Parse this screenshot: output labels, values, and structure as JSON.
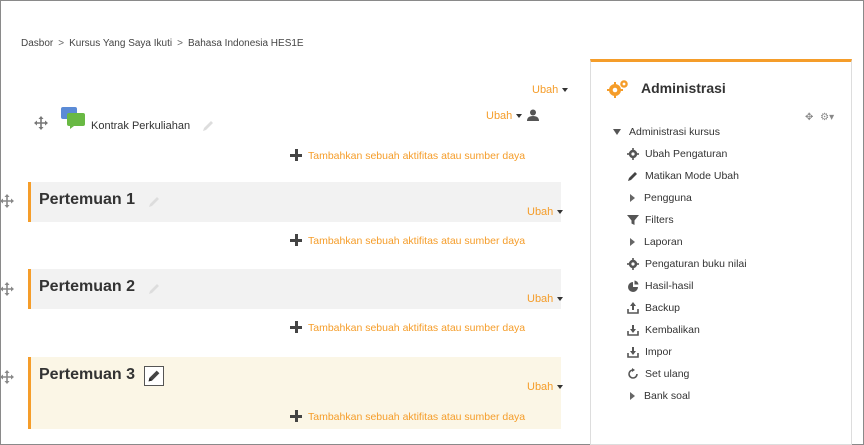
{
  "breadcrumb": {
    "items": [
      "Dasbor",
      "Kursus Yang Saya Ikuti",
      "Bahasa Indonesia HES1E"
    ],
    "separator": ">"
  },
  "top_section": {
    "ubah_label": "Ubah",
    "activity": {
      "label": "Kontrak Perkuliahan",
      "icon": "chat-bubbles-icon",
      "ubah_label": "Ubah"
    },
    "add_label": "Tambahkan sebuah aktifitas atau sumber daya"
  },
  "sections": [
    {
      "title": "Pertemuan 1",
      "ubah_label": "Ubah",
      "add_label": "Tambahkan sebuah aktifitas atau sumber daya"
    },
    {
      "title": "Pertemuan 2",
      "ubah_label": "Ubah",
      "add_label": "Tambahkan sebuah aktifitas atau sumber daya"
    },
    {
      "title": "Pertemuan 3",
      "ubah_label": "Ubah",
      "add_label": "Tambahkan sebuah aktifitas atau sumber daya"
    }
  ],
  "admin": {
    "title": "Administrasi",
    "root": "Administrasi kursus",
    "items": [
      {
        "label": "Ubah Pengaturan",
        "icon": "gear-icon"
      },
      {
        "label": "Matikan Mode Ubah",
        "icon": "pencil-icon"
      },
      {
        "label": "Pengguna",
        "icon": "expand-arrow-icon"
      },
      {
        "label": "Filters",
        "icon": "filter-icon"
      },
      {
        "label": "Laporan",
        "icon": "expand-arrow-icon"
      },
      {
        "label": "Pengaturan buku nilai",
        "icon": "gear-icon"
      },
      {
        "label": "Hasil-hasil",
        "icon": "results-icon"
      },
      {
        "label": "Backup",
        "icon": "upload-icon"
      },
      {
        "label": "Kembalikan",
        "icon": "restore-icon"
      },
      {
        "label": "Impor",
        "icon": "import-icon"
      },
      {
        "label": "Set ulang",
        "icon": "reset-icon"
      },
      {
        "label": "Bank soal",
        "icon": "expand-arrow-icon"
      }
    ]
  },
  "colors": {
    "accent": "#f59d2a",
    "section_bg": "#f2f2f2",
    "highlight_bg": "#fbf6e6"
  }
}
